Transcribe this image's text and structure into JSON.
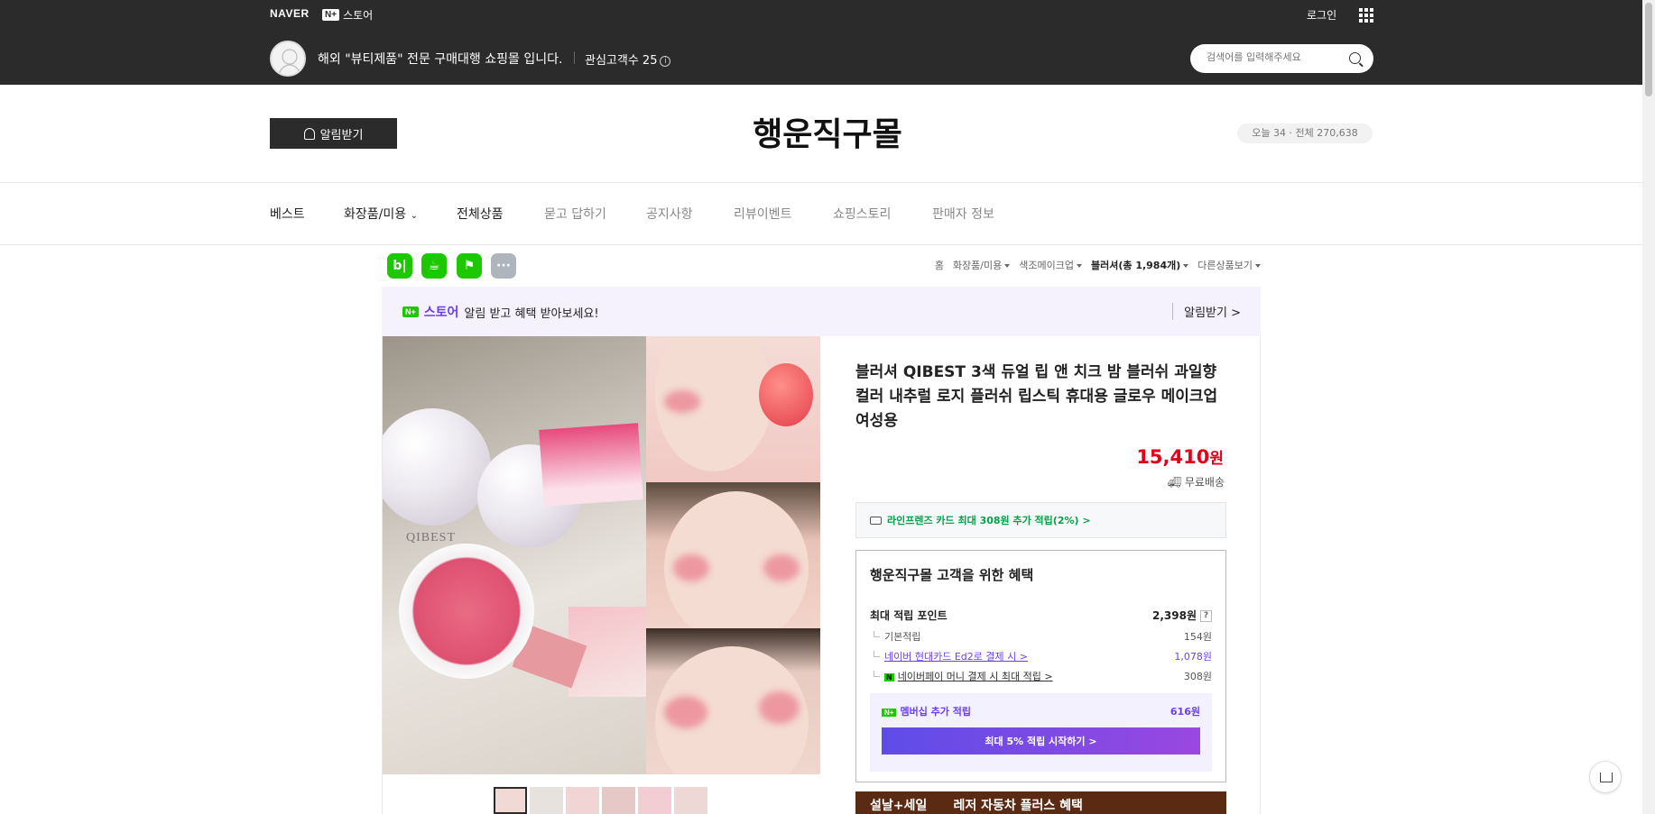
{
  "topbar": {
    "brand": "NAVER",
    "nplus": "N+",
    "store": "스토어",
    "login": "로그인",
    "slogan": "해외 \"뷰티제품\" 전문 구매대행 쇼핑몰 입니다.",
    "interest": "관심고객수 25",
    "search_placeholder": "검색어를 입력해주세요"
  },
  "store": {
    "alarm_label": "알림받기",
    "name": "행운직구몰",
    "visits": "오늘 34 · 전체 270,638"
  },
  "nav": {
    "items": [
      "베스트",
      "화장품/미용",
      "전체상품",
      "묻고 답하기",
      "공지사항",
      "리뷰이벤트",
      "쇼핑스토리",
      "판매자 정보"
    ]
  },
  "breadcrumb": {
    "items": [
      "홈",
      "화장품/미용",
      "색조메이크업",
      "블러셔(총 1,984개)",
      "다른상품보기"
    ]
  },
  "banner": {
    "store": "스토어",
    "text": "알림 받고 혜택 받아보세요!",
    "right": "알림받기 >"
  },
  "product": {
    "title": "블러셔 QIBEST 3색 듀얼 립 앤 치크 밤 블러쉬 과일향 컬러 내추럴 로지 플러쉬 립스틱 휴대용 글로우 메이크업 여성용",
    "price": "15,410",
    "price_unit": "원",
    "shipping": "무료배송",
    "card_promo": "라인프렌즈 카드 최대 308원 추가 적립(2%) >",
    "image_brand": "QIBEST"
  },
  "benefit": {
    "title": "행운직구몰 고객을 위한 혜택",
    "max_label": "최대 적립 포인트",
    "max_value": "2,398원",
    "rows": [
      {
        "label": "기본적립",
        "value": "154원"
      },
      {
        "label": "네이버 현대카드 Ed2로 결제 시 >",
        "value": "1,078원"
      },
      {
        "label": "네이버페이 머니 결제 시 최대 적립 >",
        "value": "308원"
      }
    ],
    "member_label": "멤버십 추가 적립",
    "member_value": "616원",
    "member_button": "최대 5% 적립 시작하기 >"
  },
  "sale_banner": "설날+세일      레저 자동차 플러스 혜택"
}
